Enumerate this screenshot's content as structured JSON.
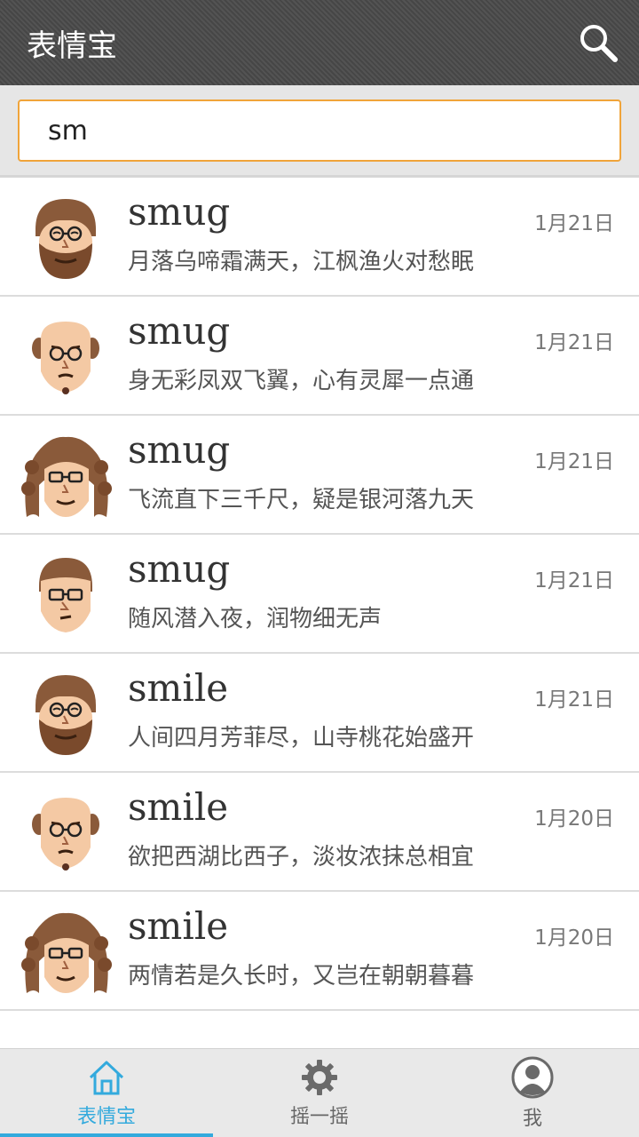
{
  "header": {
    "title": "表情宝",
    "search_icon": "search-icon"
  },
  "search": {
    "value": "sm"
  },
  "items": [
    {
      "title": "smug",
      "subtitle": "月落乌啼霜满天，江枫渔火对愁眠",
      "date": "1月21日",
      "avatar": "bearded-man-avatar"
    },
    {
      "title": "smug",
      "subtitle": "身无彩凤双飞翼，心有灵犀一点通",
      "date": "1月21日",
      "avatar": "bald-man-avatar"
    },
    {
      "title": "smug",
      "subtitle": "飞流直下三千尺，疑是银河落九天",
      "date": "1月21日",
      "avatar": "curly-hair-avatar"
    },
    {
      "title": "smug",
      "subtitle": "随风潜入夜，润物细无声",
      "date": "1月21日",
      "avatar": "glasses-man-avatar"
    },
    {
      "title": "smile",
      "subtitle": "人间四月芳菲尽，山寺桃花始盛开",
      "date": "1月21日",
      "avatar": "bearded-man-avatar"
    },
    {
      "title": "smile",
      "subtitle": "欲把西湖比西子，淡妆浓抹总相宜",
      "date": "1月20日",
      "avatar": "bald-man-avatar"
    },
    {
      "title": "smile",
      "subtitle": "两情若是久长时，又岂在朝朝暮暮",
      "date": "1月20日",
      "avatar": "curly-hair-avatar"
    }
  ],
  "nav": {
    "home_label": "表情宝",
    "shake_label": "摇一摇",
    "me_label": "我"
  },
  "colors": {
    "accent": "#33aadd",
    "search_border": "#f0a43a",
    "topbar": "#4a4a4a"
  }
}
